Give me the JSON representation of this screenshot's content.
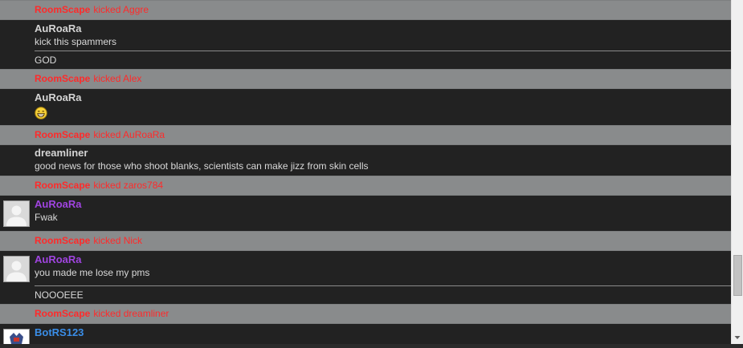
{
  "chat": {
    "rows": [
      {
        "type": "event",
        "actor": "RoomScape",
        "action": "kicked Aggre"
      },
      {
        "type": "message",
        "user": "AuRoaRa",
        "lines": [
          "kick this spammers"
        ],
        "extra": "GOD"
      },
      {
        "type": "event",
        "actor": "RoomScape",
        "action": "kicked Alex"
      },
      {
        "type": "message",
        "user": "AuRoaRa",
        "emoji": "grinning-face-emoji"
      },
      {
        "type": "event",
        "actor": "RoomScape",
        "action": "kicked AuRoaRa"
      },
      {
        "type": "message",
        "user": "dreamliner",
        "lines": [
          "good news for those who shoot blanks, scientists can make jizz from skin cells"
        ]
      },
      {
        "type": "event",
        "actor": "RoomScape",
        "action": "kicked zaros784"
      },
      {
        "type": "message",
        "user": "AuRoaRa",
        "lines": [
          "Fwak"
        ],
        "avatar": "default-avatar"
      },
      {
        "type": "event",
        "actor": "RoomScape",
        "action": "kicked Nick"
      },
      {
        "type": "message",
        "user": "AuRoaRa",
        "lines": [
          "you made me lose my pms"
        ],
        "extra": "NOOOEEE",
        "avatar": "default-avatar"
      },
      {
        "type": "event",
        "actor": "RoomScape",
        "action": "kicked dreamliner"
      },
      {
        "type": "message",
        "user": "BotRS123",
        "avatar": "bot-avatar"
      }
    ]
  },
  "colors": {
    "event_bg": "#898b8c",
    "event_text": "#ff2a2a",
    "message_bg": "#222222",
    "name_default": "#d4d4d4",
    "name_purple": "#a044e0",
    "name_blue": "#3a8ee8"
  },
  "scrollbar": {
    "position": 0.86
  }
}
